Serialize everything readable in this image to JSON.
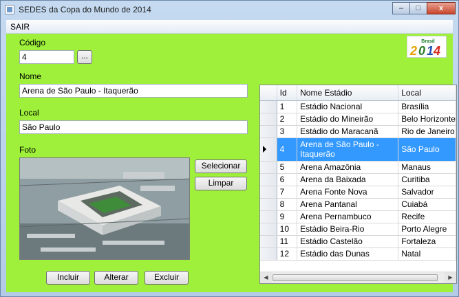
{
  "window": {
    "title": "SEDES da Copa do Mundo de 2014",
    "minimize": "–",
    "maximize": "□",
    "close": "x"
  },
  "menu": {
    "sair": "SAIR"
  },
  "form": {
    "codigo_label": "Código",
    "codigo_value": "4",
    "browse_label": "...",
    "nome_label": "Nome",
    "nome_value": "Arena de São Paulo - Itaquerão",
    "local_label": "Local",
    "local_value": "São Paulo",
    "foto_label": "Foto",
    "selecionar": "Selecionar",
    "limpar": "Limpar",
    "incluir": "Incluir",
    "alterar": "Alterar",
    "excluir": "Excluir"
  },
  "logo": {
    "text": "Brasil 2014"
  },
  "grid": {
    "columns": [
      "Id",
      "Nome Estádio",
      "Local"
    ],
    "selected_index": 3,
    "rows": [
      [
        "1",
        "Estádio Nacional",
        "Brasília"
      ],
      [
        "2",
        "Estádio do Mineirão",
        "Belo Horizonte"
      ],
      [
        "3",
        "Estádio do Maracanã",
        "Rio de Janeiro"
      ],
      [
        "4",
        "Arena de São Paulo - Itaquerão",
        "São Paulo"
      ],
      [
        "5",
        "Arena Amazônia",
        "Manaus"
      ],
      [
        "6",
        "Arena da Baixada",
        "Curitiba"
      ],
      [
        "7",
        "Arena Fonte Nova",
        "Salvador"
      ],
      [
        "8",
        "Arena Pantanal",
        "Cuiabá"
      ],
      [
        "9",
        "Arena Pernambuco",
        "Recife"
      ],
      [
        "10",
        "Estádio Beira-Rio",
        "Porto Alegre"
      ],
      [
        "11",
        "Estádio Castelão",
        "Fortaleza"
      ],
      [
        "12",
        "Estádio das Dunas",
        "Natal"
      ]
    ]
  },
  "colors": {
    "form_bg": "#9ef03a",
    "selection": "#3399ff"
  }
}
